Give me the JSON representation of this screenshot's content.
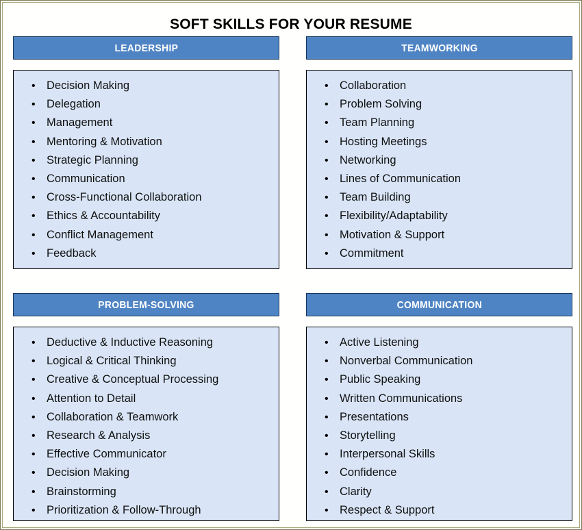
{
  "document": {
    "title": "SOFT SKILLS FOR YOUR RESUME"
  },
  "colors": {
    "header_fill": "#4F84C4",
    "header_border": "#17375E",
    "body_fill": "#D9E5F6",
    "body_border": "#000000",
    "page_border": "#A9A97C",
    "header_text": "#FFFFFF",
    "body_text": "#101010"
  },
  "bullet_glyph": "•",
  "cards": [
    {
      "id": "leadership",
      "header": "LEADERSHIP",
      "items": [
        "Decision Making",
        "Delegation",
        "Management",
        "Mentoring & Motivation",
        "Strategic Planning",
        "Communication",
        "Cross-Functional Collaboration",
        "Ethics & Accountability",
        "Conflict Management",
        "Feedback"
      ]
    },
    {
      "id": "teamworking",
      "header": "TEAMWORKING",
      "items": [
        "Collaboration",
        "Problem Solving",
        "Team Planning",
        "Hosting Meetings",
        "Networking",
        "Lines of Communication",
        "Team Building",
        "Flexibility/Adaptability",
        "Motivation & Support",
        "Commitment"
      ]
    },
    {
      "id": "problem-solving",
      "header": "PROBLEM-SOLVING",
      "items": [
        "Deductive & Inductive Reasoning",
        "Logical & Critical Thinking",
        "Creative & Conceptual Processing",
        "Attention to Detail",
        "Collaboration & Teamwork",
        "Research & Analysis",
        "Effective Communicator",
        "Decision Making",
        "Brainstorming",
        "Prioritization & Follow-Through"
      ]
    },
    {
      "id": "communication",
      "header": "COMMUNICATION",
      "items": [
        "Active Listening",
        "Nonverbal Communication",
        "Public Speaking",
        "Written Communications",
        "Presentations",
        "Storytelling",
        "Interpersonal Skills",
        "Confidence",
        "Clarity",
        "Respect & Support"
      ]
    }
  ]
}
